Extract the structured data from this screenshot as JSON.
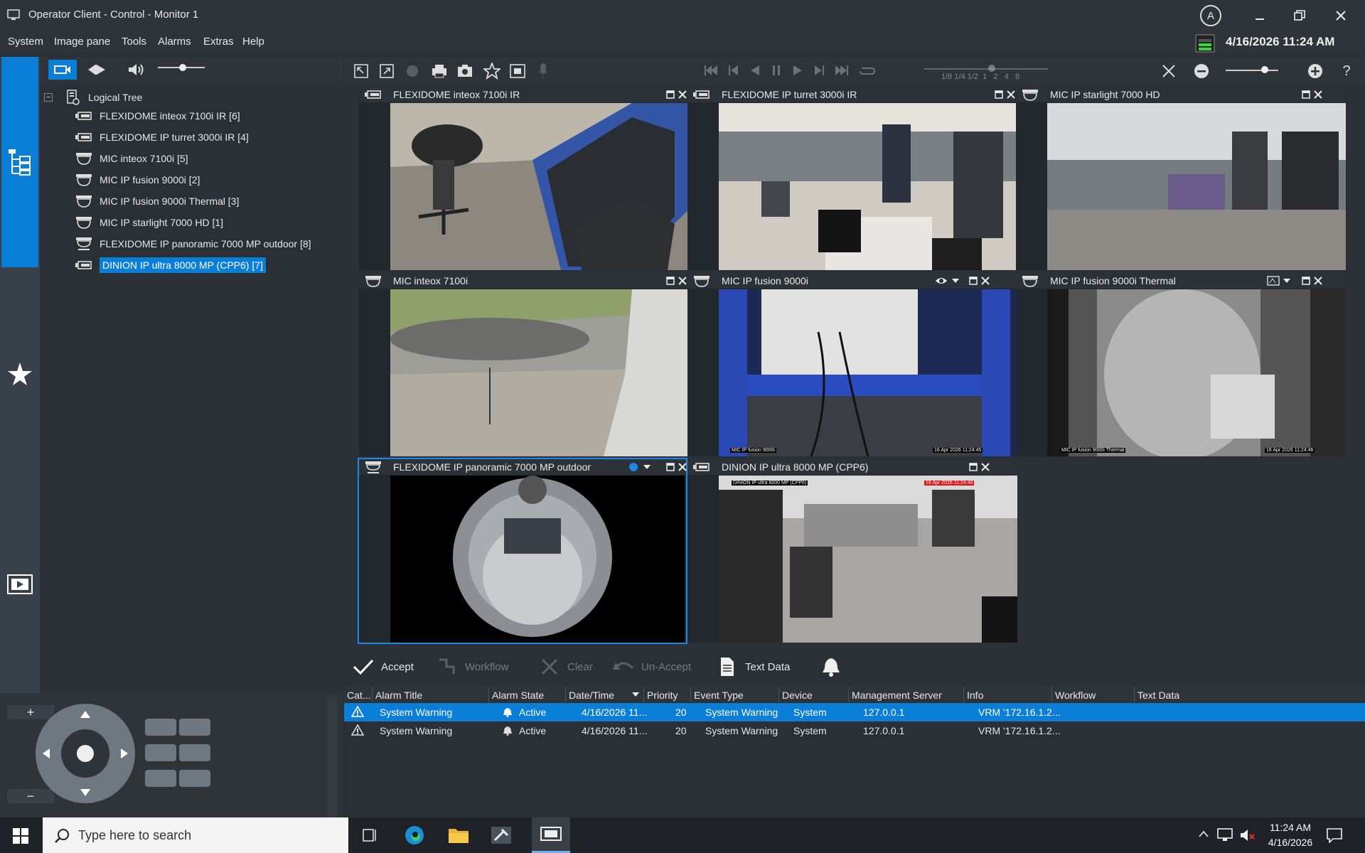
{
  "window": {
    "title": "Operator Client - Control - Monitor 1",
    "user_initial": "A"
  },
  "menu": [
    "System",
    "Image pane",
    "Tools",
    "Alarms",
    "Extras",
    "Help"
  ],
  "datetime": "4/16/2026 11:24 AM",
  "tree": {
    "root": "Logical Tree",
    "items": [
      {
        "label": "FLEXIDOME inteox 7100i IR [6]",
        "icon": "box-camera-icon"
      },
      {
        "label": "FLEXIDOME IP turret 3000i IR [4]",
        "icon": "box-camera-icon"
      },
      {
        "label": "MIC inteox 7100i [5]",
        "icon": "dome-camera-icon"
      },
      {
        "label": "MIC IP fusion 9000i [2]",
        "icon": "dome-camera-icon"
      },
      {
        "label": "MIC IP fusion 9000i Thermal [3]",
        "icon": "dome-camera-icon"
      },
      {
        "label": "MIC IP starlight 7000 HD [1]",
        "icon": "dome-camera-icon"
      },
      {
        "label": "FLEXIDOME IP panoramic 7000 MP outdoor [8]",
        "icon": "panoramic-camera-icon"
      },
      {
        "label": "DINION IP ultra 8000 MP (CPP6) [7]",
        "icon": "box-camera-icon",
        "selected": true
      }
    ]
  },
  "playback_speeds": "1/8 1/4 1/2  1   2   4   8",
  "cameras": [
    {
      "name": "FLEXIDOME inteox 7100i IR"
    },
    {
      "name": "FLEXIDOME IP turret 3000i IR"
    },
    {
      "name": "MIC IP starlight 7000 HD"
    },
    {
      "name": "MIC inteox 7100i"
    },
    {
      "name": "MIC IP fusion 9000i"
    },
    {
      "name": "MIC IP fusion 9000i Thermal"
    },
    {
      "name": "FLEXIDOME IP panoramic 7000 MP outdoor"
    },
    {
      "name": "DINION IP ultra 8000 MP (CPP6)"
    }
  ],
  "overlays": {
    "fusion_left": "MIC IP fusion 9000i",
    "fusion_right": "16 Apr 2026 11:24:45",
    "thermal_left": "MIC IP fusion 9000i Thermal",
    "thermal_right": "16 Apr 2026 11:24:46",
    "dinion_left": "DINION IP ultra 8000 MP (CPP6)",
    "dinion_right": "16 Apr 2026 11:24:48"
  },
  "alarm_buttons": {
    "accept": "Accept",
    "workflow": "Workflow",
    "clear": "Clear",
    "unaccept": "Un-Accept",
    "textdata": "Text Data"
  },
  "alarm_columns": [
    "Cat...",
    "Alarm Title",
    "Alarm State",
    "Date/Time",
    "Priority",
    "Event Type",
    "Device",
    "Management Server",
    "Info",
    "Workflow",
    "Text Data"
  ],
  "alarms": [
    {
      "title": "System Warning",
      "state": "Active",
      "datetime": "4/16/2026 11...",
      "priority": "20",
      "event": "System Warning",
      "device": "System",
      "server": "127.0.0.1",
      "info": "VRM  '172.16.1.2..."
    },
    {
      "title": "System Warning",
      "state": "Active",
      "datetime": "4/16/2026 11...",
      "priority": "20",
      "event": "System Warning",
      "device": "System",
      "server": "127.0.0.1",
      "info": "VRM  '172.16.1.2..."
    }
  ],
  "taskbar": {
    "search_placeholder": "Type here to search",
    "time": "11:24 AM",
    "date": "4/16/2026"
  },
  "colors": {
    "accent": "#0b7fd8",
    "background": "#2b3037",
    "toolbar": "#2f343b"
  }
}
